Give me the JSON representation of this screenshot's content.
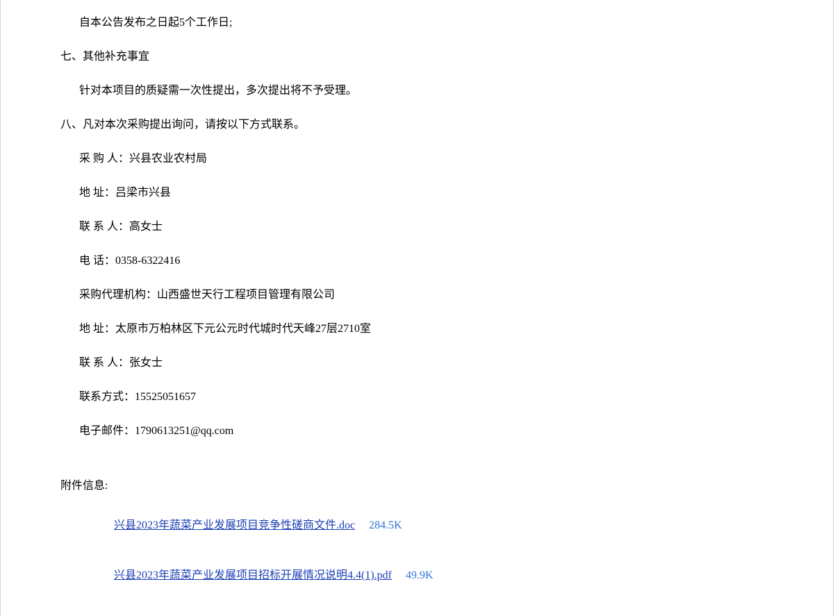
{
  "lines": {
    "deadline": "自本公告发布之日起5个工作日;",
    "section7_title": "七、其他补充事宜",
    "section7_text": "针对本项目的质疑需一次性提出，多次提出将不予受理。",
    "section8_title": "八、凡对本次采购提出询问，请按以下方式联系。"
  },
  "contacts": {
    "buyer_label": "采 购 人：",
    "buyer_value": "兴县农业农村局",
    "buyer_address_label": "地 址：",
    "buyer_address_value": "吕梁市兴县",
    "buyer_contact_label": "联 系 人：",
    "buyer_contact_value": "高女士",
    "buyer_phone_label": "电 话：",
    "buyer_phone_value": "0358-6322416",
    "agency_label": "采购代理机构：",
    "agency_value": "山西盛世天行工程项目管理有限公司",
    "agency_address_label": "地 址：",
    "agency_address_value": "太原市万柏林区下元公元时代城时代天峰27层2710室",
    "agency_contact_label": "联 系 人：",
    "agency_contact_value": "张女士",
    "agency_phone_label": "联系方式：",
    "agency_phone_value": "15525051657",
    "agency_email_label": "电子邮件：",
    "agency_email_value": "1790613251@qq.com"
  },
  "attachments": {
    "title": "附件信息:",
    "items": [
      {
        "name": "兴县2023年蔬菜产业发展项目竞争性磋商文件.doc",
        "size": "284.5K"
      },
      {
        "name": "兴县2023年蔬菜产业发展项目招标开展情况说明4.4(1).pdf",
        "size": "49.9K"
      }
    ]
  }
}
